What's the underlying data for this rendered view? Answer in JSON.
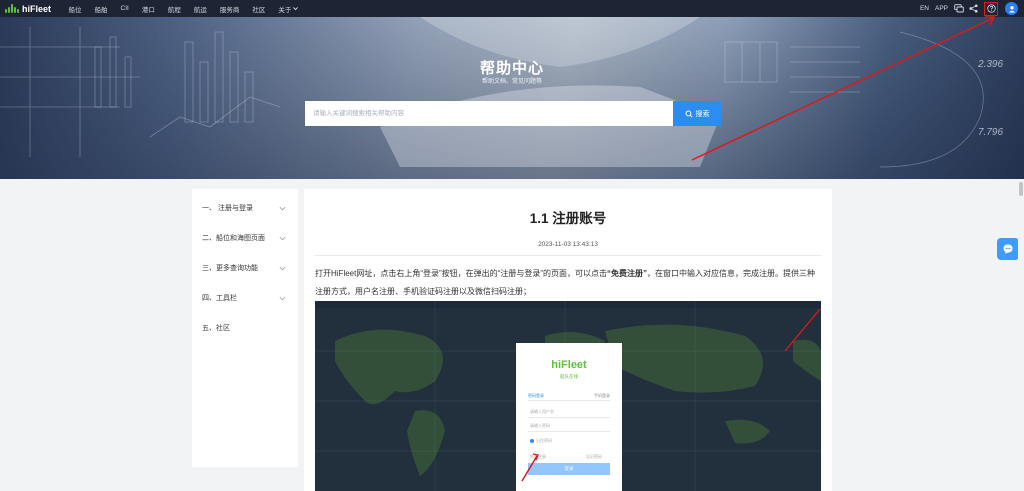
{
  "topbar": {
    "logo": "hiFleet",
    "nav": [
      "船位",
      "船舶",
      "CII",
      "港口",
      "航程",
      "航运",
      "服务商",
      "社区",
      "关于"
    ],
    "right": {
      "lang": "EN",
      "app": "APP"
    }
  },
  "hero": {
    "title": "帮助中心",
    "subtitle": "帮助文档、常见问题等",
    "search_placeholder": "请输入关键词搜索相关帮助内容",
    "search_button": "搜索"
  },
  "sidebar": {
    "items": [
      {
        "label": "一、 注册与登录"
      },
      {
        "label": "二、船位和海图页面"
      },
      {
        "label": "三、更多查询功能"
      },
      {
        "label": "四、工具栏"
      },
      {
        "label": "五、社区"
      }
    ]
  },
  "article": {
    "title": "1.1 注册账号",
    "time": "2023-11-03 13:43:13",
    "para_1": "打开HiFleet网址，点击右上角“登录”按钮，在弹出的“注册与登录”的页面，可以点击",
    "para_bold": "“免费注册”",
    "para_2": "，在窗口中输入对应信息，完成注册。提供三种注册方式，用户名注册、手机验证码注册以及微信扫码注册；"
  },
  "screenshot": {
    "logo": "hiFleet",
    "logo_sub": "船队在线",
    "tab_active": "密码登录",
    "tab_other": "手机登录",
    "user_placeholder": "请输入用户名",
    "pass_placeholder": "请输入密码",
    "remember": "记住密码",
    "register": "免费注册",
    "forgot": "忘记密码",
    "login_button": "登录"
  },
  "colors": {
    "accent": "#2d8cf0",
    "brand_green": "#5cc23a",
    "topbar": "#1d2433",
    "highlight": "#e01818"
  }
}
